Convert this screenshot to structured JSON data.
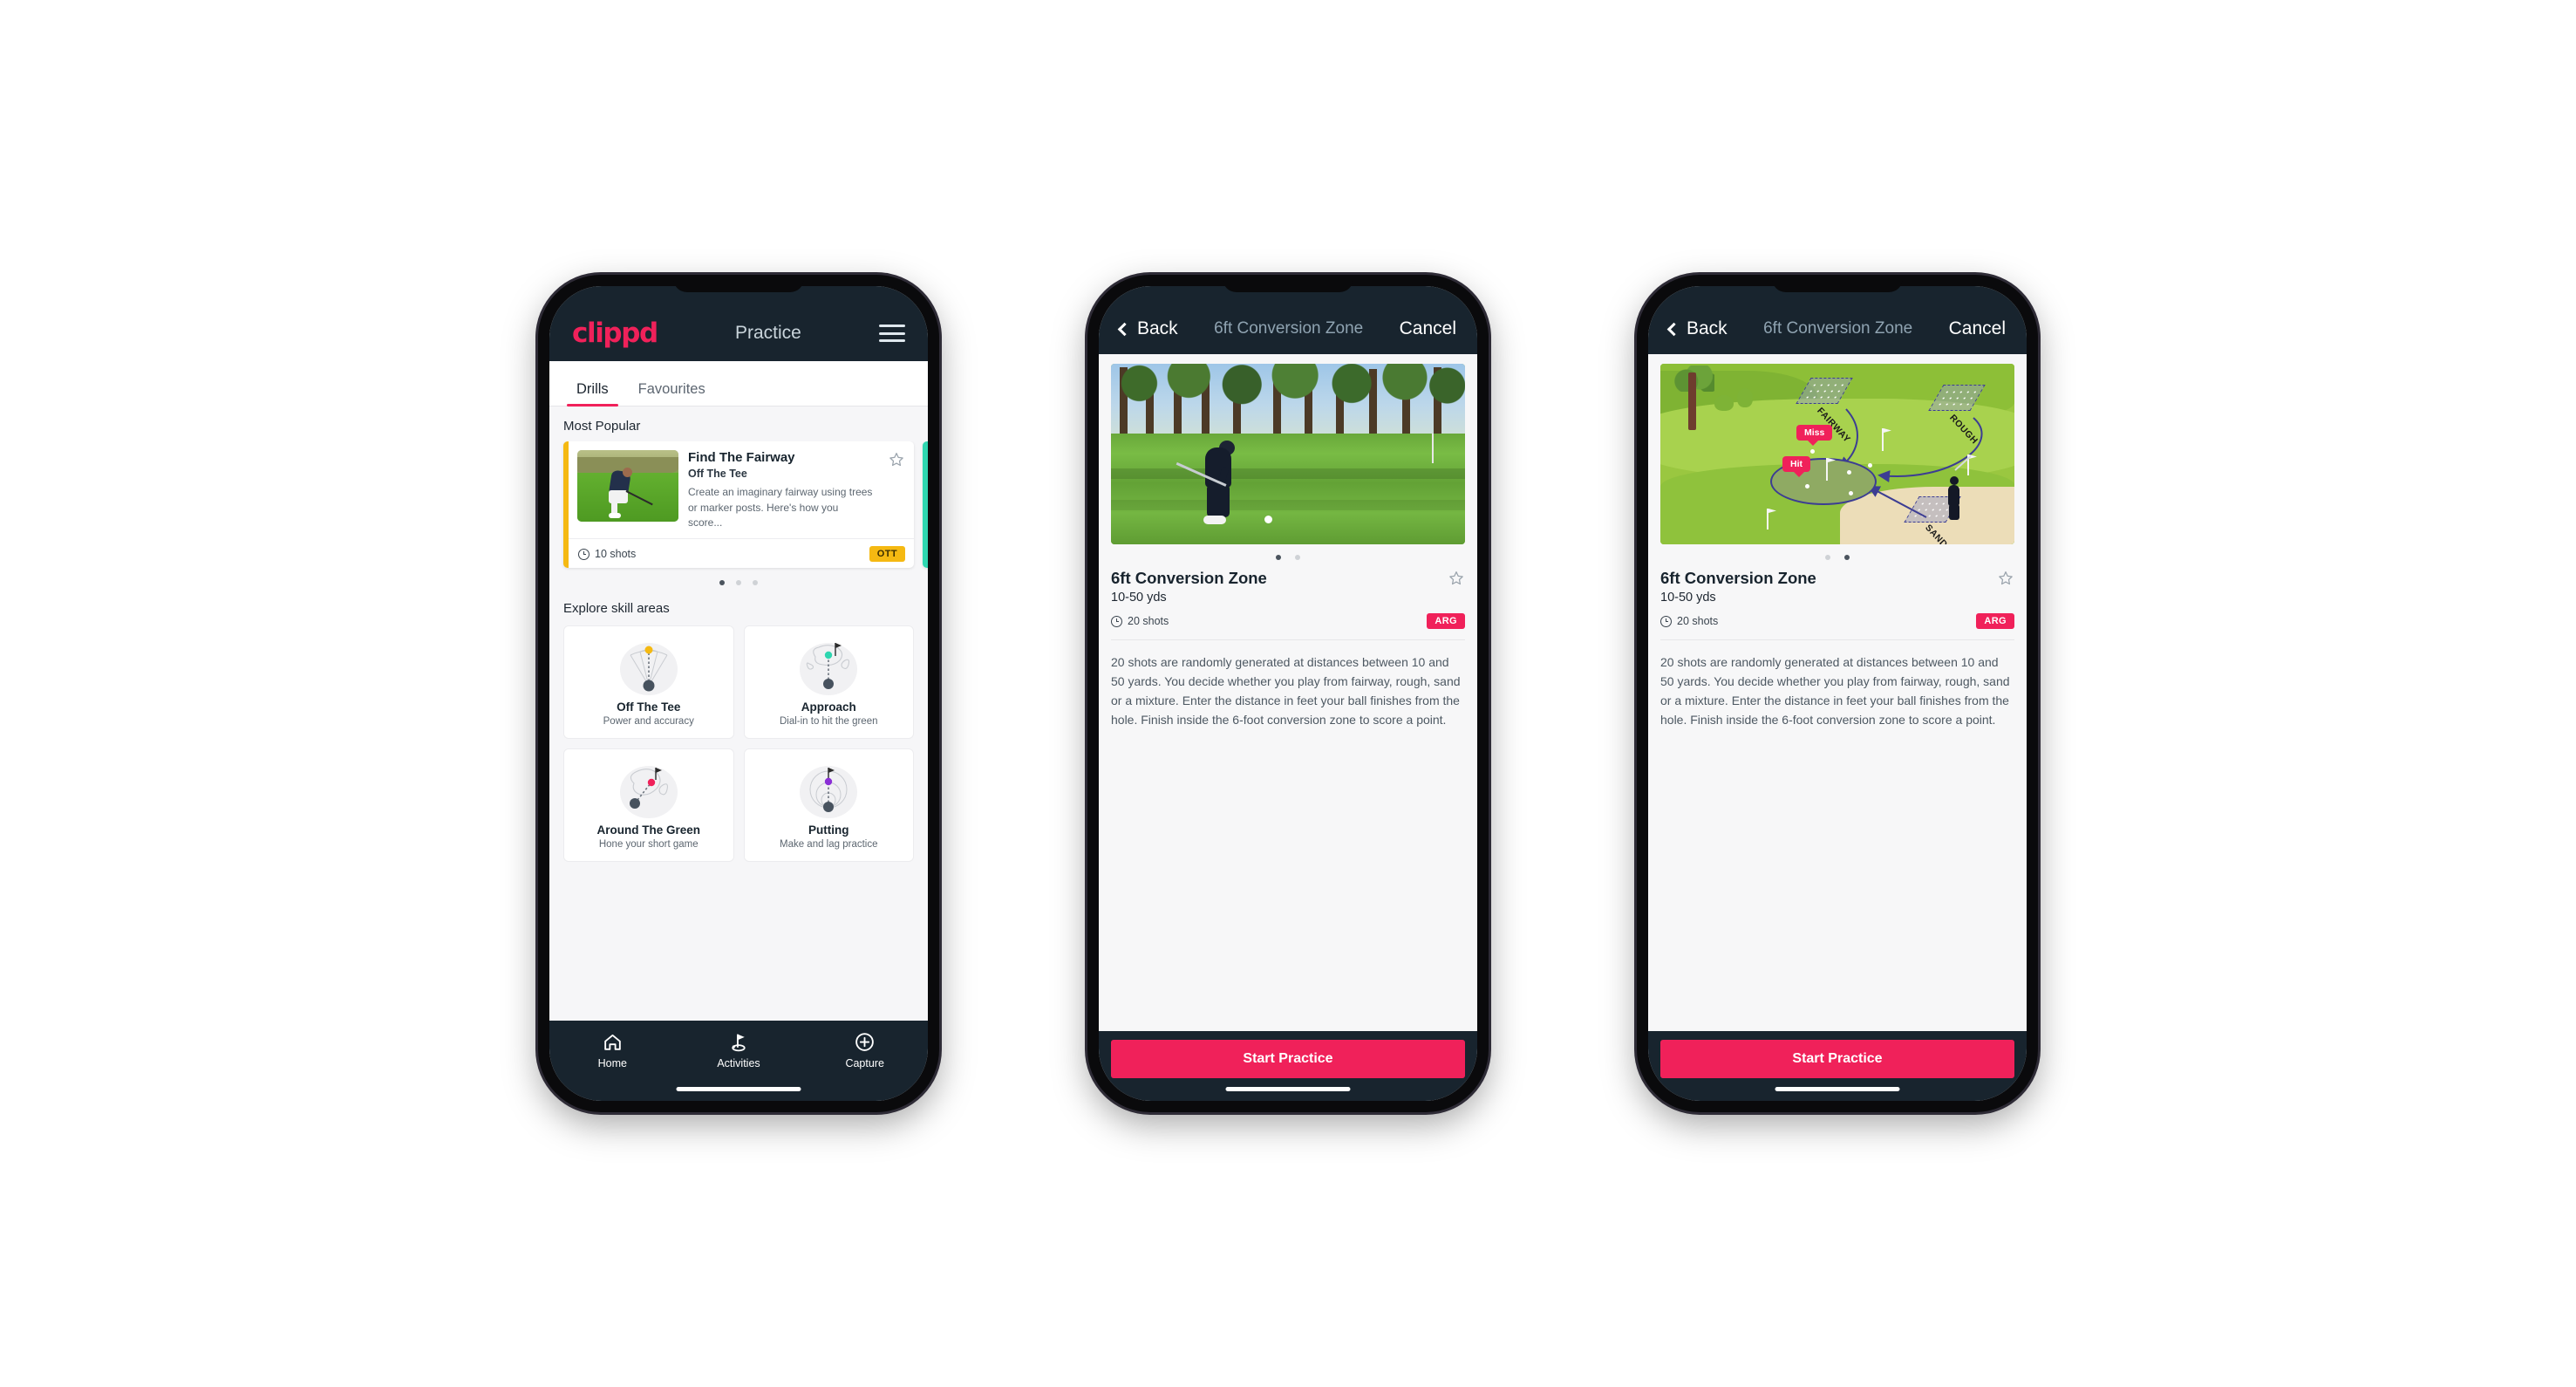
{
  "app": {
    "brand": "clippd",
    "accent_pink": "#f0215a",
    "header_dark": "#18242e",
    "badge_ott_color": "#f5b912",
    "badge_arg_color": "#f0215a",
    "card_accent_yellow": "#f5b912",
    "card_accent_teal": "#2ed6b0"
  },
  "phone1": {
    "header": {
      "logo": "clippd",
      "title": "Practice",
      "menu_icon": "hamburger-menu-icon"
    },
    "tabs": [
      {
        "label": "Drills",
        "active": true
      },
      {
        "label": "Favourites",
        "active": false
      }
    ],
    "most_popular": {
      "section_label": "Most Popular",
      "card": {
        "title": "Find The Fairway",
        "subtitle": "Off The Tee",
        "description": "Create an imaginary fairway using trees or marker posts. Here's how you score...",
        "shots": "10 shots",
        "badge": "OTT",
        "favourite_icon": "star-outline-icon",
        "clock_icon": "clock-icon"
      },
      "dots": [
        true,
        false,
        false
      ]
    },
    "skills": {
      "section_label": "Explore skill areas",
      "tiles": [
        {
          "name": "Off The Tee",
          "desc": "Power and accuracy",
          "icon": "tee-fan-icon",
          "dot_color": "#f5b912"
        },
        {
          "name": "Approach",
          "desc": "Dial-in to hit the green",
          "icon": "approach-green-icon",
          "dot_color": "#2ed6b0"
        },
        {
          "name": "Around The Green",
          "desc": "Hone your short game",
          "icon": "chip-green-icon",
          "dot_color": "#f0215a"
        },
        {
          "name": "Putting",
          "desc": "Make and lag practice",
          "icon": "putting-rings-icon",
          "dot_color": "#8b2fd6"
        }
      ]
    },
    "bottom_nav": [
      {
        "label": "Home",
        "icon": "home-icon",
        "active": false
      },
      {
        "label": "Activities",
        "icon": "golf-flag-icon",
        "active": true
      },
      {
        "label": "Capture",
        "icon": "plus-circle-icon",
        "active": false
      }
    ]
  },
  "phone2": {
    "nav": {
      "back": "Back",
      "title": "6ft Conversion Zone",
      "cancel": "Cancel",
      "back_icon": "chevron-left-icon"
    },
    "hero": {
      "type": "photo",
      "alt": "golfer-chipping-photo"
    },
    "dots": [
      true,
      false
    ],
    "detail": {
      "title": "6ft Conversion Zone",
      "yardage": "10-50 yds",
      "shots": "20 shots",
      "badge": "ARG",
      "favourite_icon": "star-outline-icon",
      "description": "20 shots are randomly generated at distances between 10 and 50 yards. You decide whether you play from fairway, rough, sand or a mixture. Enter the distance in feet your ball finishes from the hole. Finish inside the 6-foot conversion zone to score a point."
    },
    "cta": "Start Practice"
  },
  "phone3": {
    "nav": {
      "back": "Back",
      "title": "6ft Conversion Zone",
      "cancel": "Cancel",
      "back_icon": "chevron-left-icon"
    },
    "hero": {
      "type": "illustration",
      "alt": "golf-hole-diagram",
      "zone_labels": [
        "FAIRWAY",
        "ROUGH",
        "SAND"
      ],
      "markers": [
        "Miss",
        "Hit"
      ]
    },
    "dots": [
      false,
      true
    ],
    "detail": {
      "title": "6ft Conversion Zone",
      "yardage": "10-50 yds",
      "shots": "20 shots",
      "badge": "ARG",
      "favourite_icon": "star-outline-icon",
      "description": "20 shots are randomly generated at distances between 10 and 50 yards. You decide whether you play from fairway, rough, sand or a mixture. Enter the distance in feet your ball finishes from the hole. Finish inside the 6-foot conversion zone to score a point."
    },
    "cta": "Start Practice"
  }
}
